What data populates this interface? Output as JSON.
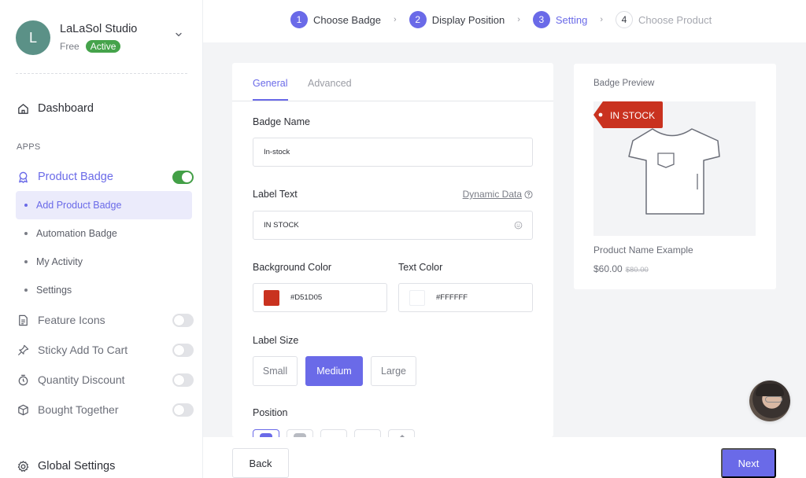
{
  "sidebar": {
    "profile": {
      "initial": "L",
      "name": "LaLaSol Studio",
      "plan": "Free",
      "status": "Active"
    },
    "dashboard_label": "Dashboard",
    "apps_heading": "APPS",
    "apps": [
      {
        "label": "Product Badge",
        "icon": "badge-icon",
        "enabled": true,
        "active": true
      },
      {
        "label": "Feature Icons",
        "icon": "document-icon",
        "enabled": false
      },
      {
        "label": "Sticky Add To Cart",
        "icon": "pin-icon",
        "enabled": false
      },
      {
        "label": "Quantity Discount",
        "icon": "stopwatch-icon",
        "enabled": false
      },
      {
        "label": "Bought Together",
        "icon": "box-icon",
        "enabled": false
      }
    ],
    "sub_items": [
      {
        "label": "Add Product Badge",
        "active": true
      },
      {
        "label": "Automation Badge",
        "active": false
      },
      {
        "label": "My Activity",
        "active": false
      },
      {
        "label": "Settings",
        "active": false
      }
    ],
    "global_settings_label": "Global Settings"
  },
  "stepper": {
    "steps": [
      {
        "number": "1",
        "label": "Choose Badge",
        "state": "done"
      },
      {
        "number": "2",
        "label": "Display Position",
        "state": "done"
      },
      {
        "number": "3",
        "label": "Setting",
        "state": "current"
      },
      {
        "number": "4",
        "label": "Choose Product",
        "state": "pending"
      }
    ],
    "separator": "›"
  },
  "form": {
    "tabs": [
      {
        "label": "General",
        "active": true
      },
      {
        "label": "Advanced",
        "active": false
      }
    ],
    "badge_name": {
      "label": "Badge Name",
      "value": "In-stock"
    },
    "label_text": {
      "label": "Label Text",
      "value": "IN STOCK",
      "dynamic_link": "Dynamic Data"
    },
    "background_color": {
      "label": "Background Color",
      "value": "#D51D05",
      "swatch": "#c9321f"
    },
    "text_color": {
      "label": "Text Color",
      "value": "#FFFFFF",
      "swatch": "#ffffff"
    },
    "label_size": {
      "label": "Label Size",
      "options": [
        "Small",
        "Medium",
        "Large"
      ],
      "selected": "Medium"
    },
    "position": {
      "label": "Position",
      "selected_index": 0
    }
  },
  "preview": {
    "title": "Badge Preview",
    "badge_text": "IN STOCK",
    "badge_color": "#c9321f",
    "product_name": "Product Name Example",
    "price": "$60.00",
    "old_price": "$80.00"
  },
  "footer": {
    "back_label": "Back",
    "next_label": "Next"
  },
  "colors": {
    "accent": "#6a6ae8",
    "toggle_on": "#43a047",
    "active_badge": "#45a34b"
  }
}
